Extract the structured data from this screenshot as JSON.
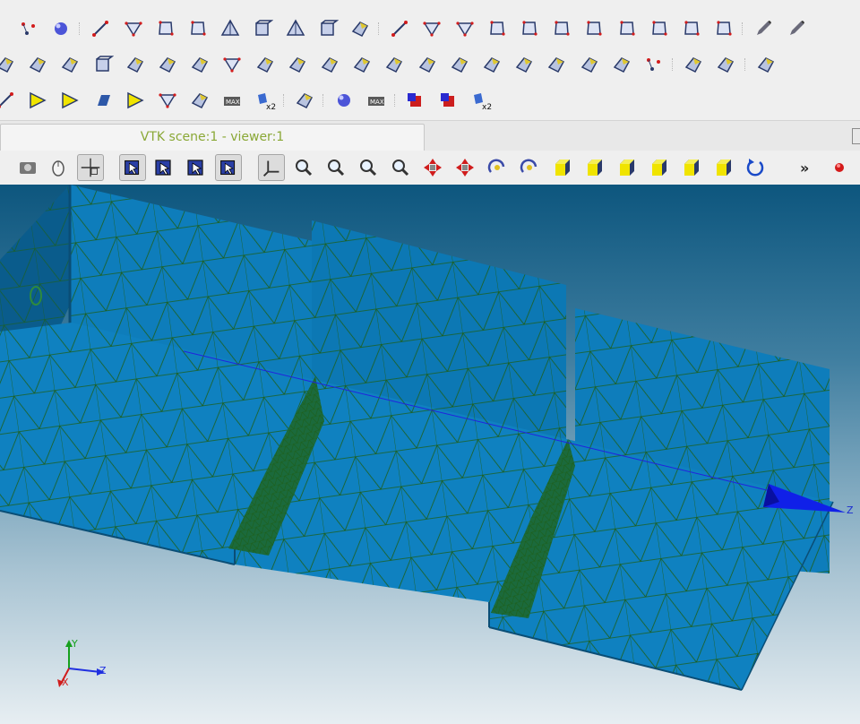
{
  "toolbars": {
    "row1": [
      "mesh-0d-icon",
      "ball-icon",
      "edge-icon",
      "triangle-icon",
      "quadrangle-icon",
      "polygon-icon",
      "tetrahedron-icon",
      "hexahedron-icon",
      "pentahedron-icon",
      "hexagonal-prism-icon",
      "polyhedron-icon",
      "quadratic-edge-icon",
      "quadratic-triangle-icon",
      "biquadratic-triangle-icon",
      "quadratic-quadrangle-icon",
      "biquadratic-quadrangle-icon",
      "quadratic-polygon-icon",
      "quadratic-tetrahedron-icon",
      "quadratic-pyramid-icon",
      "quadratic-pentahedron-icon",
      "quadratic-hexahedron-icon",
      "triquadratic-hexahedron-icon",
      "pencil-icon",
      "edit-icon"
    ],
    "row2": [
      "ruler-icon",
      "volume-icon",
      "orientation-icon",
      "grid-icon",
      "reorient-icon",
      "cut-quad-icon",
      "split-face-icon",
      "union-triangles-icon",
      "diagonal-icon",
      "smoothing-icon",
      "extrusion-icon",
      "scale-icon",
      "sewing-icon",
      "revolution-icon",
      "pattern-icon",
      "merge-icon",
      "extrusion-path-icon",
      "cutting-icon",
      "fill-hole-icon",
      "merge-elements-icon",
      "nodes-icon",
      "split-volumes-icon",
      "duplicate-icon",
      "convert-icon"
    ],
    "row3": [
      "free-edges-icon",
      "free-faces-icon",
      "yellow-triangle-icon",
      "parallelogram-icon",
      "yellow-tri-2-icon",
      "triangle-outline-icon",
      "warping-icon",
      "max-element-icon",
      "bare-border-x2-icon",
      "skew-icon",
      "color-balls-icon",
      "max-element-3d-icon",
      "red-cube-icon",
      "blue-red-cube-icon",
      "over-constrained-x2-icon"
    ]
  },
  "viewer_tab": {
    "title": "VTK scene:1 - viewer:1"
  },
  "view_toolbar": {
    "buttons": [
      "dump-view-icon",
      "mouse-icon",
      "pick-point-icon",
      "select-nodes-icon",
      "select-elements-icon",
      "select-faces-icon",
      "select-volumes-icon",
      "trihedron-icon",
      "fit-all-icon",
      "fit-area-icon",
      "zoom-icon",
      "zoom-in-icon",
      "pan-icon",
      "global-pan-icon",
      "rotate-icon",
      "rotation-point-icon",
      "front-view-icon",
      "back-view-icon",
      "top-view-icon",
      "bottom-view-icon",
      "left-view-icon",
      "right-view-icon",
      "reset-view-icon"
    ],
    "more": "»",
    "record": "record-icon"
  },
  "axes": {
    "x": "X",
    "y": "Y",
    "z": "Z",
    "z_marker": "Z"
  },
  "colors": {
    "mesh_face": "#0f81c0",
    "mesh_edge": "#1d5f1a",
    "accent": "#8aa836"
  }
}
